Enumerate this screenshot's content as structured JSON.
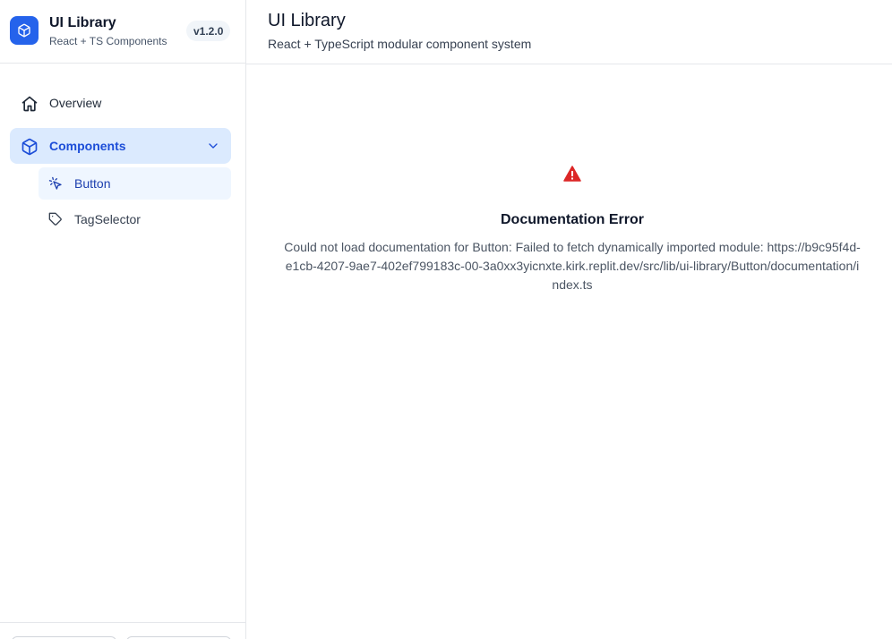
{
  "brand": {
    "title": "UI Library",
    "subtitle": "React + TS Components",
    "version": "v1.2.0",
    "logo_icon": "cube-icon",
    "accent": "#2563eb"
  },
  "nav": {
    "items": [
      {
        "label": "Overview",
        "icon": "home-icon",
        "active": false
      },
      {
        "label": "Components",
        "icon": "cube-icon",
        "active": true,
        "expanded": true
      }
    ],
    "sub_items": [
      {
        "label": "Button",
        "icon": "cursor-click-icon",
        "active": true
      },
      {
        "label": "TagSelector",
        "icon": "tag-icon",
        "active": false
      }
    ]
  },
  "header": {
    "title": "UI Library",
    "subtitle": "React + TypeScript modular component system"
  },
  "error": {
    "icon": "warning-triangle-icon",
    "icon_color": "#dc2626",
    "title": "Documentation Error",
    "message": "Could not load documentation for Button: Failed to fetch dynamically imported module: https://b9c95f4d-e1cb-4207-9ae7-402ef799183c-00-3a0xx3yicnxte.kirk.replit.dev/src/lib/ui-library/Button/documentation/index.ts"
  }
}
